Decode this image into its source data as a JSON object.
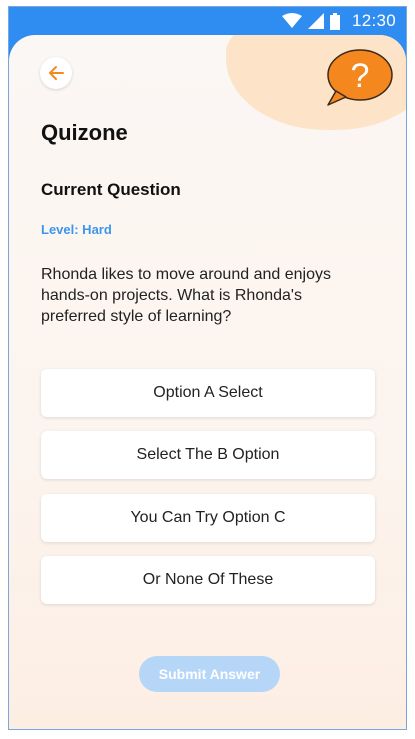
{
  "status_bar": {
    "time": "12:30",
    "icons": [
      "wifi-icon",
      "signal-icon",
      "battery-icon"
    ]
  },
  "header": {
    "back_icon": "arrow-left-icon",
    "help_icon": "question-bubble-icon",
    "app_title": "Quizone"
  },
  "question": {
    "heading": "Current Question",
    "level": "Level: Hard",
    "text": "Rhonda likes to move around and enjoys hands-on projects. What is Rhonda's preferred style of learning?"
  },
  "options": [
    "Option A Select",
    "Select The B Option",
    "You Can Try Option C",
    "Or None Of These"
  ],
  "submit": {
    "label": "Submit Answer",
    "state": "disabled"
  },
  "colors": {
    "status_bar": "#2f8cf0",
    "accent_orange": "#f5871f",
    "level_blue": "#3c95ee",
    "submit_disabled": "#b6d6f8",
    "blob": "#fde4c9"
  }
}
